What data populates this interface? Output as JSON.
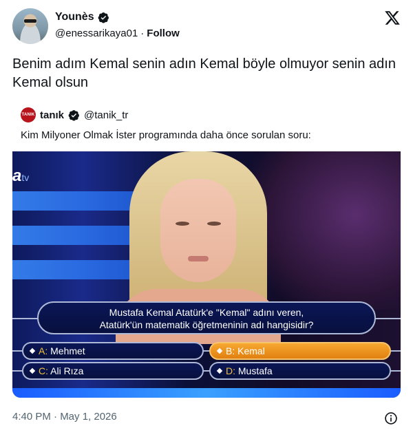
{
  "author": {
    "display_name": "Younès",
    "handle": "@enessarikaya01",
    "separator": "·",
    "follow_label": "Follow"
  },
  "tweet": {
    "text": "Benim adım Kemal senin adın Kemal böyle olmuyor senin adın Kemal olsun"
  },
  "quoted": {
    "avatar_text": "TANIK",
    "name": "tanık",
    "handle": "@tanik_tr",
    "text": "Kim Milyoner Olmak İster programında daha önce sorulan soru:"
  },
  "media": {
    "channel": "a",
    "channel_suffix": "tv",
    "question": {
      "line1": "Mustafa Kemal Atatürk'e \"Kemal\" adını veren,",
      "line2": "Atatürk'ün matematik öğretmeninin adı hangisidir?"
    },
    "answers": [
      {
        "letter": "A:",
        "text": "Mehmet",
        "selected": false
      },
      {
        "letter": "B:",
        "text": "Kemal",
        "selected": true
      },
      {
        "letter": "C:",
        "text": "Ali Rıza",
        "selected": false
      },
      {
        "letter": "D:",
        "text": "Mustafa",
        "selected": false
      }
    ],
    "selected_color": "#f39a1f"
  },
  "footer": {
    "timestamp": "4:40 PM · May 1, 2026"
  },
  "icons": {
    "verified": "verified-badge-icon",
    "x_logo": "x-logo-icon",
    "info": "info-icon"
  },
  "colors": {
    "text": "#0f1419",
    "muted": "#536471",
    "accent_orange": "#f39a1f"
  }
}
